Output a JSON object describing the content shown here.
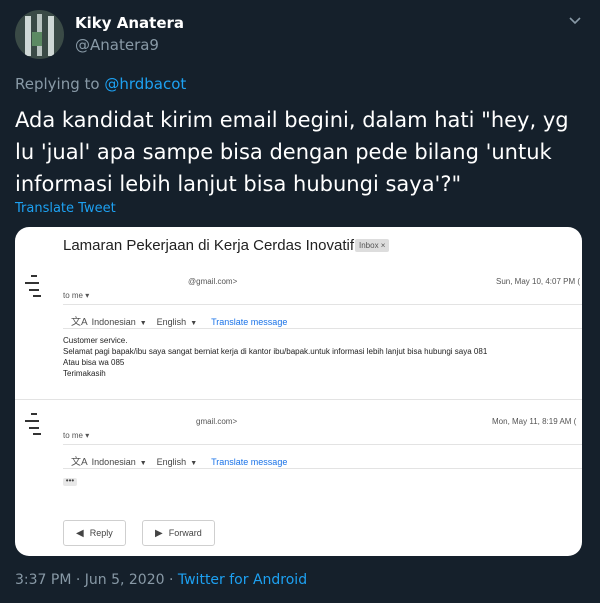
{
  "tweet": {
    "display_name": "Kiky Anatera",
    "handle": "@Anatera9",
    "replying_prefix": "Replying to ",
    "replying_to": "@hrdbacot",
    "text": "Ada kandidat kirim email begini, dalam hati \"hey, yg lu 'jual' apa sampe bisa dengan pede bilang 'untuk informasi lebih lanjut bisa hubungi saya'?\"",
    "translate_label": "Translate Tweet",
    "timestamp": "3:37 PM · Jun 5, 2020 · ",
    "source": "Twitter for Android"
  },
  "email": {
    "subject": "Lamaran Pekerjaan di Kerja Cerdas Inovatif",
    "label": "Inbox ×",
    "messages": [
      {
        "sender_email": "@gmail.com>",
        "date": "Sun, May 10, 4:07 PM (",
        "to": "to me ▾",
        "lang_from": "Indonesian",
        "lang_to": "English",
        "translate": "Translate message",
        "body": [
          "Customer service.",
          "Selamat pagi bapak/ibu saya sangat berniat kerja di kantor ibu/bapak.untuk informasi lebih lanjut bisa hubungi saya 081",
          "Atau bisa wa 085",
          "Terimakasih"
        ]
      },
      {
        "sender_email": "gmail.com>",
        "date": "Mon, May 11, 8:19 AM (",
        "to": "to me ▾",
        "lang_from": "Indonesian",
        "lang_to": "English",
        "translate": "Translate message",
        "ellipsis": "•••"
      }
    ],
    "reply_label": "Reply",
    "forward_label": "Forward"
  }
}
